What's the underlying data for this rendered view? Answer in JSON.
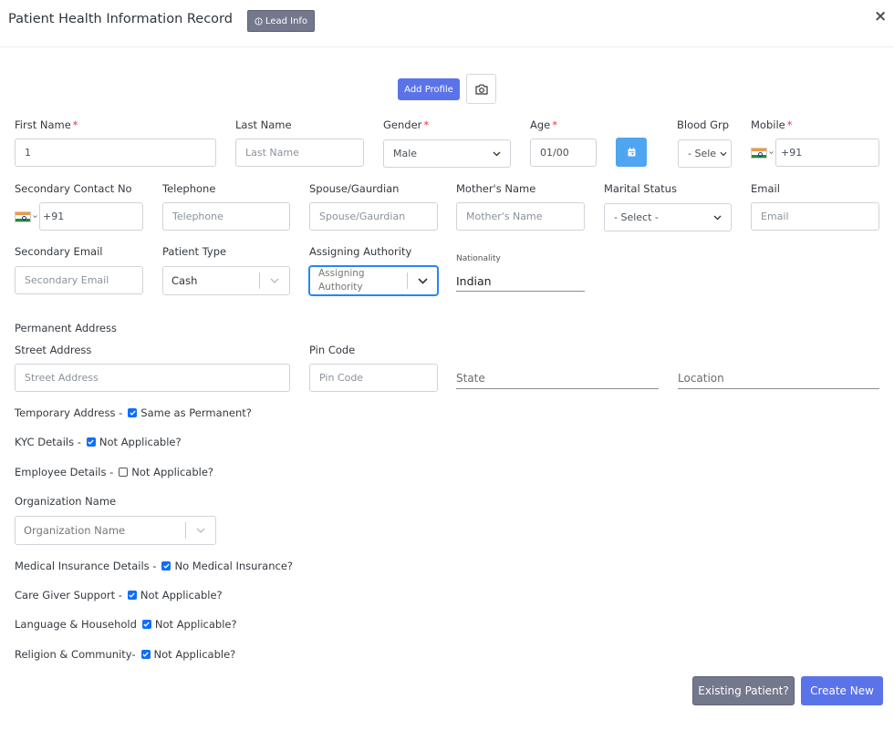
{
  "header": {
    "title": "Patient Health Information Record",
    "lead_info": "Lead Info",
    "close": "×"
  },
  "profile": {
    "add_profile": "Add Profile"
  },
  "labels": {
    "first_name": "First Name",
    "last_name": "Last Name",
    "gender": "Gender",
    "age": "Age",
    "blood_grp": "Blood Grp",
    "mobile": "Mobile",
    "secondary_contact": "Secondary Contact No",
    "telephone": "Telephone",
    "spouse": "Spouse/Gaurdian",
    "mother": "Mother's Name",
    "marital": "Marital Status",
    "email": "Email",
    "secondary_email": "Secondary Email",
    "patient_type": "Patient Type",
    "assigning_authority": "Assigning Authority",
    "nationality": "Nationality",
    "permanent_address": "Permanent Address",
    "street_address": "Street Address",
    "pin_code": "Pin Code",
    "organization_name": "Organization Name",
    "required_mark": "*"
  },
  "fields": {
    "first_name": {
      "value": "1",
      "placeholder": ""
    },
    "last_name": {
      "value": "",
      "placeholder": "Last Name"
    },
    "gender": {
      "selected": "Male"
    },
    "age": {
      "value": "01/00"
    },
    "blood_grp": {
      "selected": "- Sele"
    },
    "mobile": {
      "value": "+91"
    },
    "secondary_contact": {
      "value": "+91"
    },
    "telephone": {
      "placeholder": "Telephone"
    },
    "spouse": {
      "placeholder": "Spouse/Gaurdian"
    },
    "mother": {
      "placeholder": "Mother's Name"
    },
    "marital": {
      "selected": "- Select -"
    },
    "email": {
      "placeholder": "Email"
    },
    "secondary_email": {
      "placeholder": "Secondary Email"
    },
    "patient_type": {
      "selected": "Cash"
    },
    "assigning_authority": {
      "placeholder": "Assigning Authority"
    },
    "nationality": {
      "value": "Indian"
    },
    "street_address": {
      "placeholder": "Street Address"
    },
    "pin_code": {
      "placeholder": "Pin Code"
    },
    "state": {
      "placeholder": "State"
    },
    "location": {
      "placeholder": "Location"
    },
    "organization_name": {
      "placeholder": "Organization Name"
    }
  },
  "sections": {
    "temporary_address": {
      "label": "Temporary Address -",
      "check_label": "Same as Permanent?",
      "checked": true
    },
    "kyc": {
      "label": "KYC Details -",
      "check_label": "Not Applicable?",
      "checked": true
    },
    "employee": {
      "label": "Employee Details -",
      "check_label": "Not Applicable?",
      "checked": false
    },
    "medical_insurance": {
      "label": "Medical Insurance Details -",
      "check_label": "No Medical Insurance?",
      "checked": true
    },
    "care_giver": {
      "label": "Care Giver Support -",
      "check_label": "Not Applicable?",
      "checked": true
    },
    "language": {
      "label": "Language & Household",
      "check_label": "Not Applicable?",
      "checked": true
    },
    "religion": {
      "label": "Religion & Community-",
      "check_label": "Not Applicable?",
      "checked": true
    }
  },
  "footer": {
    "existing_patient": "Existing Patient?",
    "create_new": "Create New"
  },
  "colors": {
    "primary": "#5b73e8",
    "secondary": "#74788d",
    "info": "#50a5f1",
    "required": "#e63946",
    "checkbox": "#0d6efd"
  },
  "icons": {
    "lead_info": "info-circle-icon",
    "close": "close-icon",
    "camera": "camera-icon",
    "calendar": "calendar-icon",
    "chevron": "chevron-down-icon",
    "flag": "india-flag-icon",
    "checkbox": "checkmark-icon"
  }
}
